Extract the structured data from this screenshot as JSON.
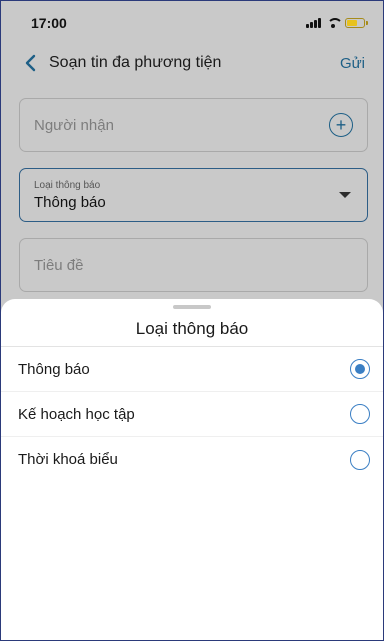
{
  "status_bar": {
    "time": "17:00"
  },
  "header": {
    "title": "Soạn tin đa phương tiện",
    "send_label": "Gửi"
  },
  "form": {
    "recipient_placeholder": "Người nhận",
    "type_field_label": "Loại thông báo",
    "type_field_value": "Thông báo",
    "subject_placeholder": "Tiêu đề"
  },
  "sheet": {
    "title": "Loại thông báo",
    "options": [
      {
        "label": "Thông báo",
        "selected": true
      },
      {
        "label": "Kế hoạch học tập",
        "selected": false
      },
      {
        "label": "Thời khoá biểu",
        "selected": false
      }
    ]
  },
  "colors": {
    "accent": "#3b7fc4",
    "nav_blue": "#1d5f86",
    "battery": "#e8c21c"
  }
}
